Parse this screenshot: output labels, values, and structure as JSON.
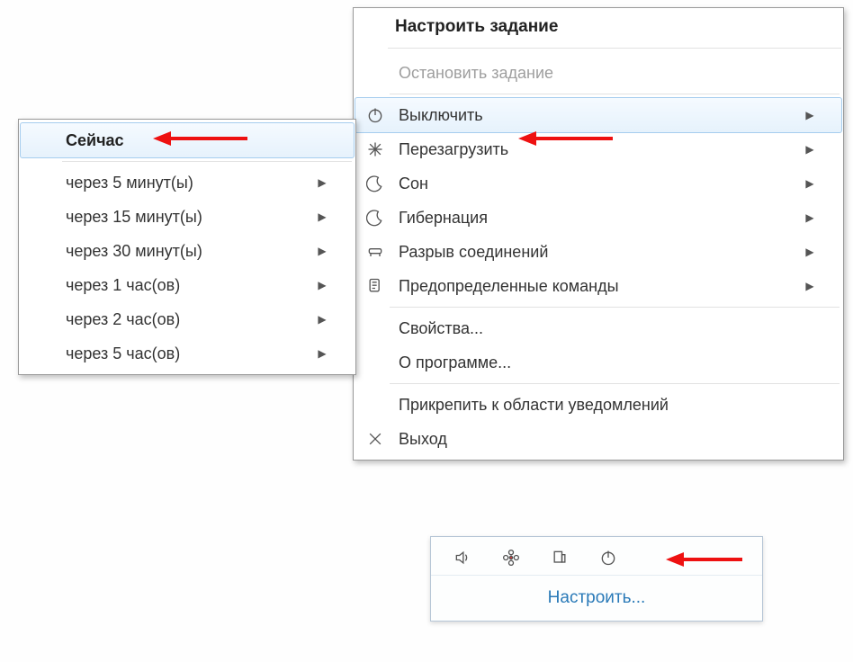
{
  "main_menu": {
    "header": "Настроить задание",
    "stop": "Остановить задание",
    "shutdown": "Выключить",
    "restart": "Перезагрузить",
    "sleep": "Сон",
    "hibernate": "Гибернация",
    "disconnect": "Разрыв соединений",
    "predefined": "Предопределенные команды",
    "properties": "Свойства...",
    "about": "О программе...",
    "pin": "Прикрепить к области уведомлений",
    "exit": "Выход"
  },
  "submenu": {
    "now": "Сейчас",
    "in5m": "через 5 минут(ы)",
    "in15m": "через 15 минут(ы)",
    "in30m": "через 30 минут(ы)",
    "in1h": "через 1 час(ов)",
    "in2h": "через 2 час(ов)",
    "in5h": "через 5 час(ов)"
  },
  "tray": {
    "configure": "Настроить..."
  }
}
